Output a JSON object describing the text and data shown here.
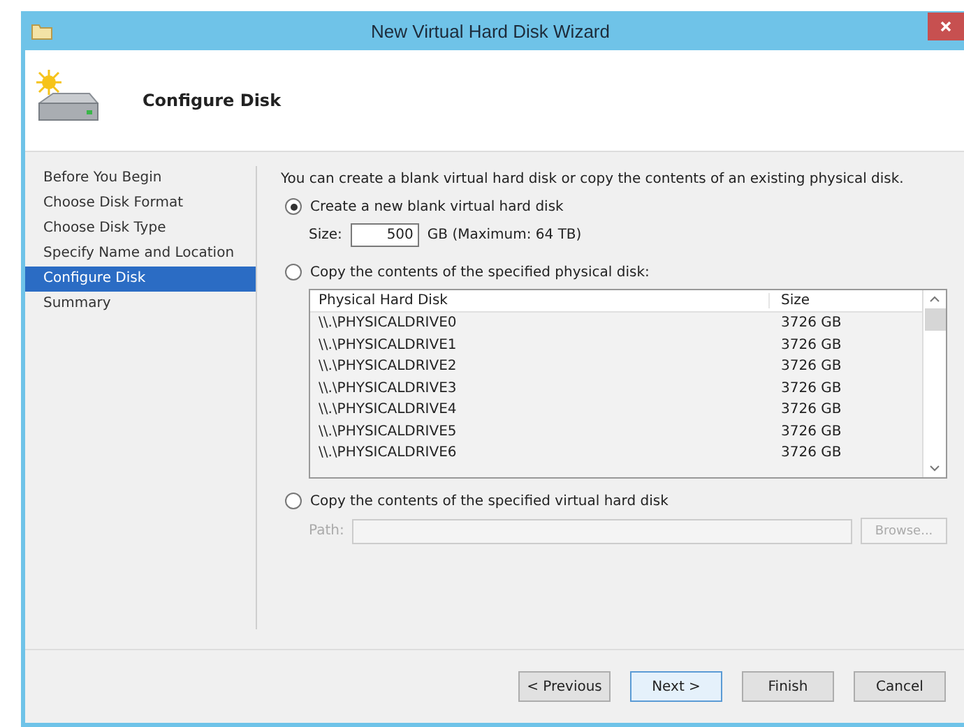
{
  "window": {
    "title": "New Virtual Hard Disk Wizard"
  },
  "header": {
    "title": "Configure Disk"
  },
  "nav": [
    {
      "label": "Before You Begin",
      "selected": false
    },
    {
      "label": "Choose Disk Format",
      "selected": false
    },
    {
      "label": "Choose Disk Type",
      "selected": false
    },
    {
      "label": "Specify Name and Location",
      "selected": false
    },
    {
      "label": "Configure Disk",
      "selected": true
    },
    {
      "label": "Summary",
      "selected": false
    }
  ],
  "intro": "You can create a blank virtual hard disk or copy the contents of an existing physical disk.",
  "options": [
    {
      "kind": "size",
      "label": "Create a new blank virtual hard disk",
      "selected": true,
      "field_label": "Size:",
      "value": "500",
      "unit": "GB (Maximum: 64 TB)"
    },
    {
      "kind": "list",
      "label": "Copy the contents of the specified physical disk:",
      "selected": false,
      "columns": [
        "Physical Hard Disk",
        "Size"
      ],
      "rows": [
        [
          "\\\\.\\PHYSICALDRIVE0",
          "3726 GB"
        ],
        [
          "\\\\.\\PHYSICALDRIVE1",
          "3726 GB"
        ],
        [
          "\\\\.\\PHYSICALDRIVE2",
          "3726 GB"
        ],
        [
          "\\\\.\\PHYSICALDRIVE3",
          "3726 GB"
        ],
        [
          "\\\\.\\PHYSICALDRIVE4",
          "3726 GB"
        ],
        [
          "\\\\.\\PHYSICALDRIVE5",
          "3726 GB"
        ],
        [
          "\\\\.\\PHYSICALDRIVE6",
          "3726 GB"
        ]
      ]
    },
    {
      "kind": "path",
      "label": "Copy the contents of the specified virtual hard disk",
      "selected": false,
      "field_label": "Path:",
      "disabled": true,
      "button": "Browse..."
    }
  ],
  "buttons": [
    {
      "label": "< Previous",
      "default": false
    },
    {
      "label": "Next >",
      "default": true
    },
    {
      "label": "Finish",
      "default": false
    },
    {
      "label": "Cancel",
      "default": false
    }
  ]
}
